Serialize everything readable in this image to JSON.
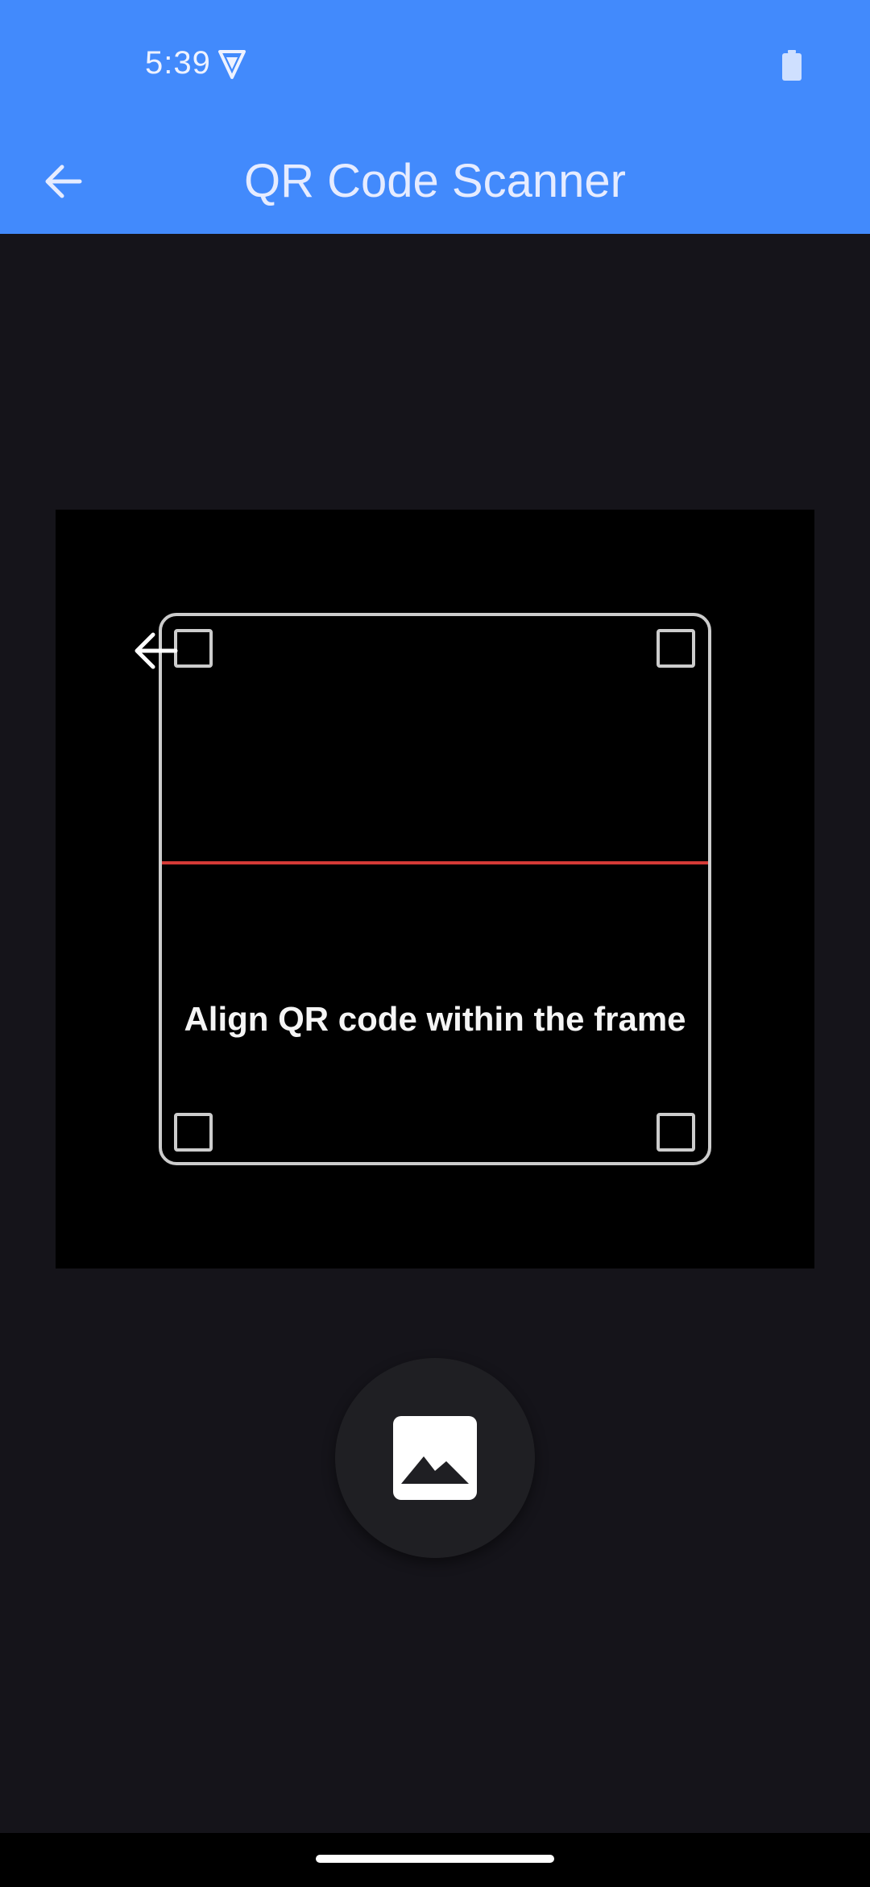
{
  "status_bar": {
    "time": "5:39",
    "vpn_icon": "vpn-shield-icon",
    "battery_icon": "battery-icon"
  },
  "app_bar": {
    "title": "QR Code Scanner",
    "back_icon": "arrow-back-icon"
  },
  "scanner": {
    "hint": "Align QR code within the frame",
    "scan_line_color": "#d43a36",
    "frame_color": "#cccccc"
  },
  "actions": {
    "gallery_icon": "image-gallery-icon"
  },
  "colors": {
    "primary": "#428afc",
    "background": "#15141a",
    "camera": "#000000"
  }
}
